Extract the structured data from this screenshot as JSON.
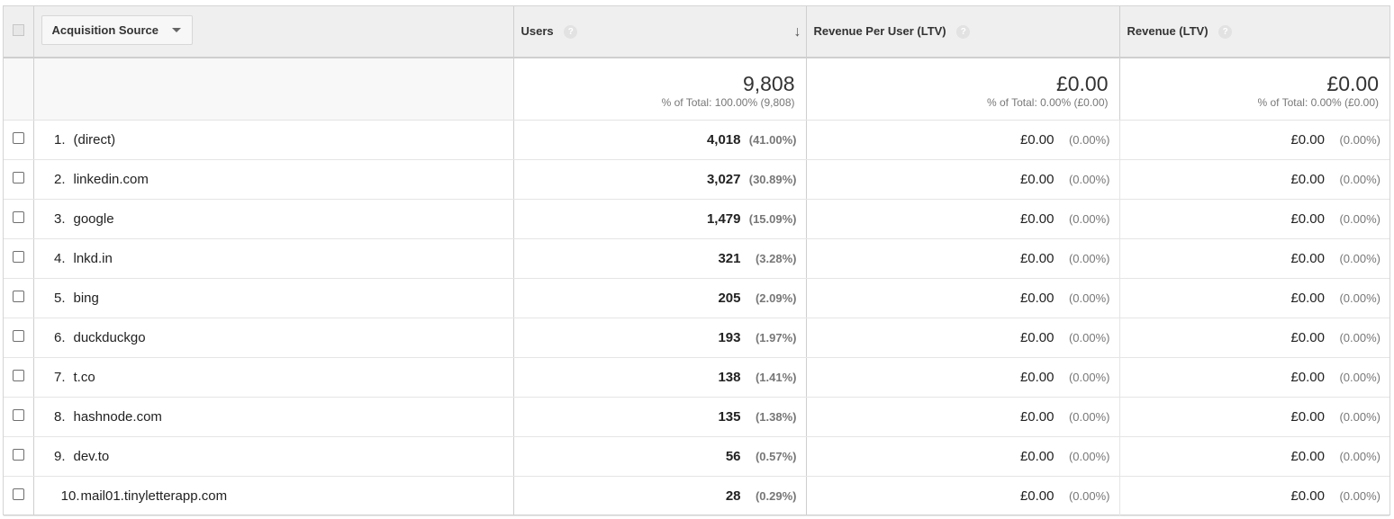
{
  "header": {
    "dimension_label": "Acquisition Source",
    "users_label": "Users",
    "rpu_label": "Revenue Per User (LTV)",
    "revenue_label": "Revenue (LTV)",
    "help_glyph": "?",
    "sort_glyph": "↓"
  },
  "totals": {
    "users_value": "9,808",
    "users_sub": "% of Total: 100.00% (9,808)",
    "rpu_value": "£0.00",
    "rpu_sub": "% of Total: 0.00% (£0.00)",
    "revenue_value": "£0.00",
    "revenue_sub": "% of Total: 0.00% (£0.00)"
  },
  "rows": [
    {
      "index": "1.",
      "source": "(direct)",
      "users": "4,018",
      "users_pct": "(41.00%)",
      "rpu": "£0.00",
      "rpu_pct": "(0.00%)",
      "revenue": "£0.00",
      "revenue_pct": "(0.00%)"
    },
    {
      "index": "2.",
      "source": "linkedin.com",
      "users": "3,027",
      "users_pct": "(30.89%)",
      "rpu": "£0.00",
      "rpu_pct": "(0.00%)",
      "revenue": "£0.00",
      "revenue_pct": "(0.00%)"
    },
    {
      "index": "3.",
      "source": "google",
      "users": "1,479",
      "users_pct": "(15.09%)",
      "rpu": "£0.00",
      "rpu_pct": "(0.00%)",
      "revenue": "£0.00",
      "revenue_pct": "(0.00%)"
    },
    {
      "index": "4.",
      "source": "lnkd.in",
      "users": "321",
      "users_pct": "(3.28%)",
      "rpu": "£0.00",
      "rpu_pct": "(0.00%)",
      "revenue": "£0.00",
      "revenue_pct": "(0.00%)"
    },
    {
      "index": "5.",
      "source": "bing",
      "users": "205",
      "users_pct": "(2.09%)",
      "rpu": "£0.00",
      "rpu_pct": "(0.00%)",
      "revenue": "£0.00",
      "revenue_pct": "(0.00%)"
    },
    {
      "index": "6.",
      "source": "duckduckgo",
      "users": "193",
      "users_pct": "(1.97%)",
      "rpu": "£0.00",
      "rpu_pct": "(0.00%)",
      "revenue": "£0.00",
      "revenue_pct": "(0.00%)"
    },
    {
      "index": "7.",
      "source": "t.co",
      "users": "138",
      "users_pct": "(1.41%)",
      "rpu": "£0.00",
      "rpu_pct": "(0.00%)",
      "revenue": "£0.00",
      "revenue_pct": "(0.00%)"
    },
    {
      "index": "8.",
      "source": "hashnode.com",
      "users": "135",
      "users_pct": "(1.38%)",
      "rpu": "£0.00",
      "rpu_pct": "(0.00%)",
      "revenue": "£0.00",
      "revenue_pct": "(0.00%)"
    },
    {
      "index": "9.",
      "source": "dev.to",
      "users": "56",
      "users_pct": "(0.57%)",
      "rpu": "£0.00",
      "rpu_pct": "(0.00%)",
      "revenue": "£0.00",
      "revenue_pct": "(0.00%)"
    },
    {
      "index": "10.",
      "source": "mail01.tinyletterapp.com",
      "users": "28",
      "users_pct": "(0.29%)",
      "rpu": "£0.00",
      "rpu_pct": "(0.00%)",
      "revenue": "£0.00",
      "revenue_pct": "(0.00%)"
    }
  ],
  "icons": {
    "help": "help-circle-icon",
    "sort": "arrow-down-icon",
    "dropdown": "caret-down-icon"
  },
  "colors": {
    "header_bg": "#efefef",
    "help_bg": "#e2e2e2",
    "muted_text": "#777777"
  }
}
